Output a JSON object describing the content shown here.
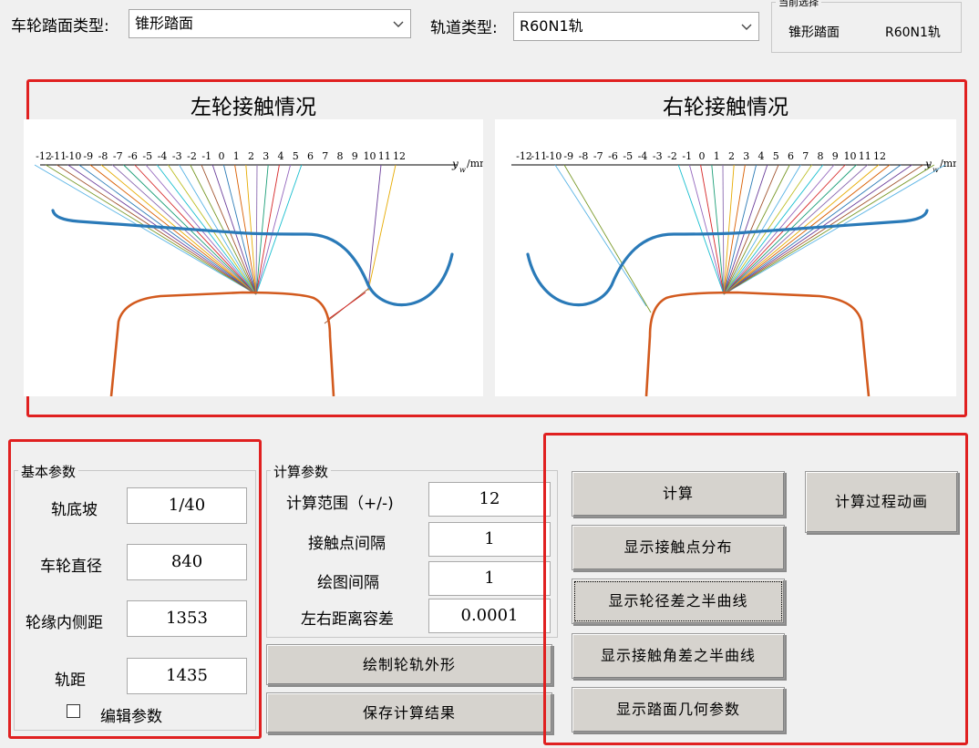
{
  "top": {
    "wheel_label": "车轮踏面类型:",
    "wheel_value": "锥形踏面",
    "track_label": "轨道类型:",
    "track_value": "R60N1轨",
    "current": {
      "title": "当前选择",
      "wheel": "锥形踏面",
      "track": "R60N1轨"
    }
  },
  "plots": {
    "left_title": "左轮接触情况",
    "right_title": "右轮接触情况",
    "axis_unit": "/mm",
    "axis_var": "y",
    "axis_sub": "w",
    "ticks": [
      "-12",
      "-11",
      "-10",
      "-9",
      "-8",
      "-7",
      "-6",
      "-5",
      "-4",
      "-3",
      "-2",
      "-1",
      "0",
      "1",
      "2",
      "3",
      "4",
      "5",
      "6",
      "7",
      "8",
      "9",
      "10",
      "11",
      "12"
    ],
    "wheel_color": "#2a7ab8",
    "rail_color": "#d25a1e"
  },
  "basic": {
    "title": "基本参数",
    "rows": [
      {
        "label": "轨底坡",
        "value": "1/40"
      },
      {
        "label": "车轮直径",
        "value": "840"
      },
      {
        "label": "轮缘内侧距",
        "value": "1353"
      },
      {
        "label": "轨距",
        "value": "1435"
      }
    ],
    "edit_label": "编辑参数"
  },
  "calc": {
    "title": "计算参数",
    "rows": [
      {
        "label": "计算范围（+/-)",
        "value": "12"
      },
      {
        "label": "接触点间隔",
        "value": "1"
      },
      {
        "label": "绘图间隔",
        "value": "1"
      },
      {
        "label": "左右距离容差",
        "value": "0.0001"
      }
    ]
  },
  "buttons": {
    "draw_profile": "绘制轮轨外形",
    "save": "保存计算结果",
    "calc": "计算",
    "contact_dist": "显示接触点分布",
    "radius_diff": "显示轮径差之半曲线",
    "angle_diff": "显示接触角差之半曲线",
    "tread_geom": "显示踏面几何参数",
    "animation": "计算过程动画"
  }
}
